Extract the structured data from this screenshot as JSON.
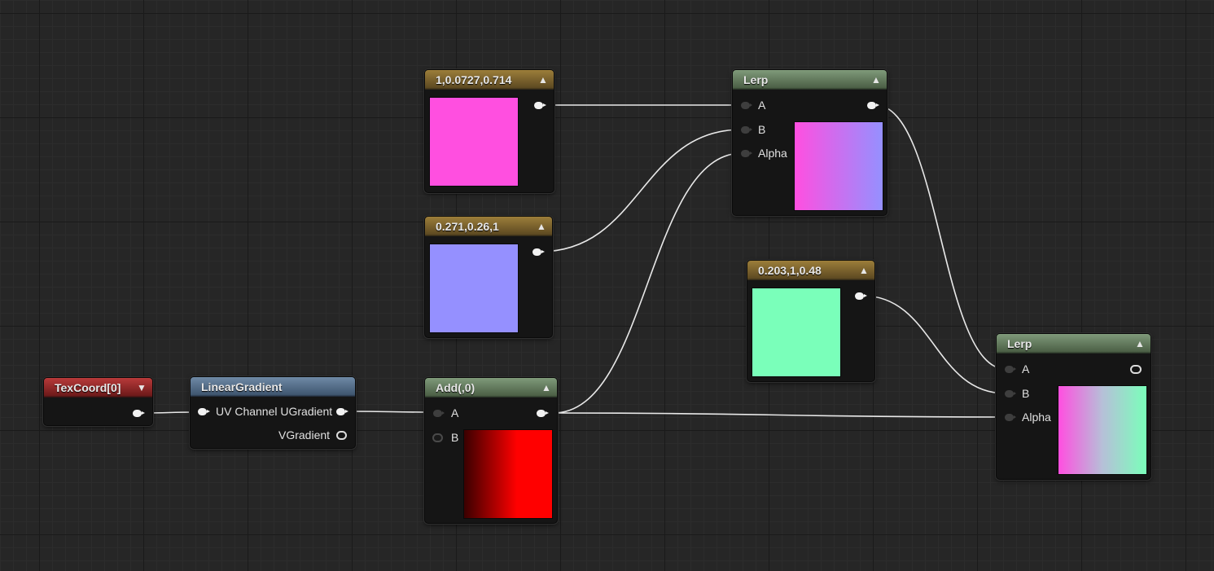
{
  "nodes": {
    "const_pink": {
      "title": "1,0.0727,0.714",
      "color": "#ff4fe0"
    },
    "const_purple": {
      "title": "0.271,0.26,1",
      "color": "#9590ff"
    },
    "const_green": {
      "title": "0.203,1,0.48",
      "color": "#7affba"
    },
    "texcoord": {
      "title": "TexCoord[0]"
    },
    "linear_gradient": {
      "title": "LinearGradient",
      "pins": {
        "out1": "UV Channel UGradient",
        "out2": "VGradient"
      }
    },
    "add": {
      "title": "Add(,0)",
      "pins": {
        "a": "A",
        "b": "B"
      }
    },
    "lerp_top": {
      "title": "Lerp",
      "pins": {
        "a": "A",
        "b": "B",
        "alpha": "Alpha"
      }
    },
    "lerp_bottom": {
      "title": "Lerp",
      "pins": {
        "a": "A",
        "b": "B",
        "alpha": "Alpha"
      }
    }
  },
  "icons": {
    "collapse": "chevron-up-icon",
    "dropdown": "chevron-down-icon"
  }
}
